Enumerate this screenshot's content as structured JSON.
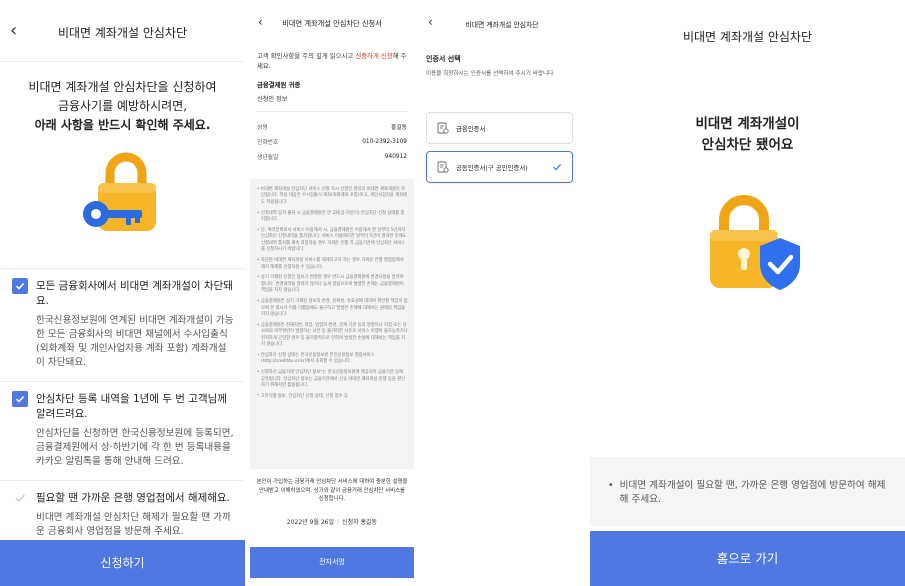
{
  "colors": {
    "primary": "#4f78e0",
    "accent_red": "#e0352b",
    "lock_gold": "#f7b528",
    "key_blue": "#2b6de0"
  },
  "screen1": {
    "title": "비대면 계좌개설 안심차단",
    "intro_line1": "비대면 계좌개설 안심차단을 신청하여",
    "intro_line2": "금융사기를 예방하시려면,",
    "intro_line3": "아래 사항을 반드시 확인해 주세요.",
    "items": [
      {
        "checked": true,
        "title": "모든 금융회사에서 비대면 계좌개설이 차단돼요.",
        "desc": "한국신용정보원에 연계된 비대면 계좌개설이 가능한 모든 금융회사의 비대면 채널에서 수시입출식(외화계좌 및 개인사업자용 계좌 포함) 계좌개설이 차단돼요."
      },
      {
        "checked": true,
        "title": "안심차단 등록 내역을 1년에 두 번 고객님께 알려드려요.",
        "desc": "안심차단을 신청하면 한국신용정보원에 등록되면, 금융결제원에서 상·하반기에 각 한 번 등록내용을 카카오 알림톡을 통해 안내해 드려요."
      },
      {
        "checked": false,
        "title": "필요할 땐 가까운 은행 영업점에서 해제해요.",
        "desc": "비대면 계좌개설 안심차단 해제가 필요할 땐 가까운 금융회사 영업점을 방문해 주세요."
      }
    ],
    "cta": "신청하기"
  },
  "screen2": {
    "title": "비대면 계좌개설 안심차단 신청서",
    "lead_pre": "고객 확인사항을 주의 깊게 읽으시고 ",
    "lead_red": "신중하게 신청",
    "lead_post": "해 주세요.",
    "section": "금융결제원 귀중",
    "subsection": "신청인 정보",
    "fields": [
      {
        "label": "성명",
        "value": "홍길동"
      },
      {
        "label": "전화번호",
        "value": "010-2392-3109"
      },
      {
        "label": "생년월일",
        "value": "940912"
      }
    ],
    "notices": [
      "• 비대면 계좌개설 안심차단 서비스 신청 즉시 신청인 명의의 비대면 계좌개설이 차단됩니다. 적용 대상은 수시입출식 계좌(외화계좌 포함)이고, 개인사업자용 계좌에도 적용됩니다.",
      "• 신청내역 등치 출처 시 금융결제원은 안 2회(상·하반기) 안심차단 신청 상태를 통지합니다.",
      "• 단, 여러분위로서 서비스 이용해서 시, 금융결제원은 이용해서 한 날부터 5년까지 안심차단 신청내역을 통지합니다. 서비스 이용해지한 날부터 5년이 경과한 후에도 신청내역 통지를 계속 희망하실 경우 가까운 은행 각 금융기관에 안심차단 서비스를 신청하시기 바랍니다.",
      "• 차단된 비대면 계좌개설 서비스를 재개하고자 하는 경우 가까운 은행 영업점에서 해지 해제를 신청하실 수 있습니다.",
      "• 상기 기재된 신청인 정보가 변경된 경우 반드시 금융결제원에 변경사항을 알려야 합니다. 변경내역을 알리지 않거나 늦게 알림으로써 발생한 손해는 금융결제원이 책임을 지지 않습니다.",
      "• 금융결제원은 상기 기재된 정보의 변경, 진위성, 유효성에 대하여 확인할 책임이 없으며 본 회사가 이를 다했음에도 불구하고 발생한 손해에 대해서는 원래의 책임을 지지 않습니다.",
      "• 금융결제원은 천재지변, 파업, 법령의 변경, 관계 기관 등의 명령이나 지침 또는 당사자의 의무위반이 발생하는 사안 등 불가피한 사유로 서비스 이행이 불가능하거나 현저하게 곤란한 경우 등 불가항력으로 인하여 발생한 손실에 대해서는 책임을 지지 않습니다.",
      "• 안심차단 신청 상태는 한국신용정보원 본인신용정보 열람서비스(http://credit4u.or.kr)에서 조회할 수 있습니다.",
      "• 신청하신 금융거래 안심차단 정보*는 한국신용정보원에 제공되어 금융기관 등에 공유됩니다. 안심차단 정보는 금융기관에서 신규 비대면 계좌개설 진행 등을 판단하기 위해서만 활용됩니다.",
      "* 고유식별 정보, 안심차단 신청 상태, 신청 접수 등"
    ],
    "agree": "본인이 가입하는 금융거래 안심차단 서비스에 대하여 충분한 설명을 안내받고 이해하였으며, 상기와 같이 금융거래 안심차단 서비스를 신청합니다.",
    "date": "2022년 9월 26일",
    "signer": "신청자 홍길동",
    "cta": "전자서명"
  },
  "screen3": {
    "title": "비대면 계좌개설 안심차단",
    "heading": "인증서 선택",
    "sub": "이용을 희망하시는 인증서를 선택하여 주시기 바랍니다.",
    "options": [
      {
        "label": "금융인증서",
        "selected": false
      },
      {
        "label": "공동인증서(구 공인인증서)",
        "selected": true
      }
    ]
  },
  "screen4": {
    "title": "비대면 계좌개설 안심차단",
    "done_line1": "비대면 계좌개설이",
    "done_line2": "안심차단 됐어요",
    "info": "비대면 계좌개설이 필요할 땐, 가까운 은행 영업점에 방문하여 해제해 주세요.",
    "cta": "홈으로 가기"
  }
}
